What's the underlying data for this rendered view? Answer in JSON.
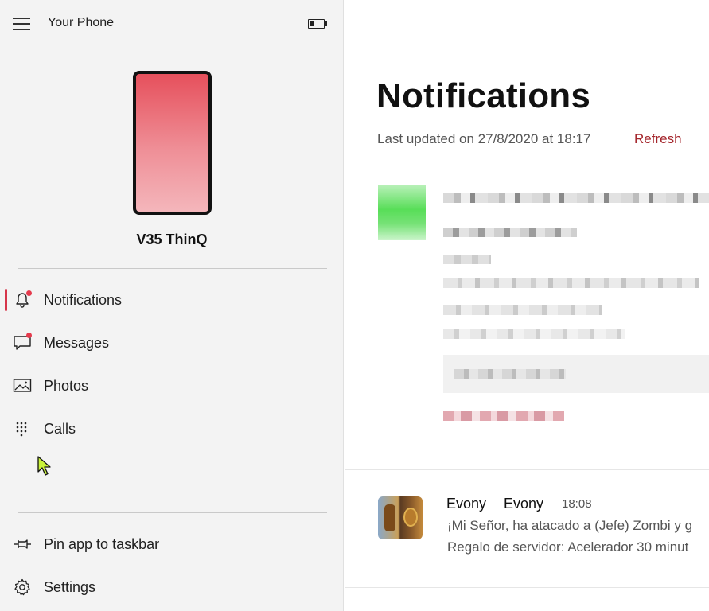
{
  "app": {
    "title": "Your Phone",
    "battery_level": 0.35
  },
  "device": {
    "name": "V35 ThinQ",
    "screen_gradient": [
      "#e6505c",
      "#f4b6bb"
    ]
  },
  "nav": {
    "items": [
      {
        "label": "Notifications",
        "icon": "bell-icon",
        "badge": true,
        "active": true
      },
      {
        "label": "Messages",
        "icon": "chat-bubble-icon",
        "badge": true,
        "active": false
      },
      {
        "label": "Photos",
        "icon": "image-icon",
        "badge": false,
        "active": false
      },
      {
        "label": "Calls",
        "icon": "dialpad-icon",
        "badge": false,
        "active": false
      }
    ],
    "footer": [
      {
        "label": "Pin app to taskbar",
        "icon": "pin-icon"
      },
      {
        "label": "Settings",
        "icon": "gear-icon"
      }
    ]
  },
  "main": {
    "title": "Notifications",
    "last_updated": "Last updated on 27/8/2020 at 18:17",
    "refresh_label": "Refresh",
    "notifications": [
      {
        "app": "Evony",
        "title": "Evony",
        "time": "18:08",
        "lines": [
          "¡Mi Señor, ha atacado a (Jefe) Zombi y g",
          "Regalo de servidor: Acelerador 30 minut"
        ],
        "icon": "evony-app-icon"
      }
    ]
  },
  "colors": {
    "accent": "#d6354a",
    "badge": "#e53a4d",
    "refresh": "#a4262c"
  }
}
